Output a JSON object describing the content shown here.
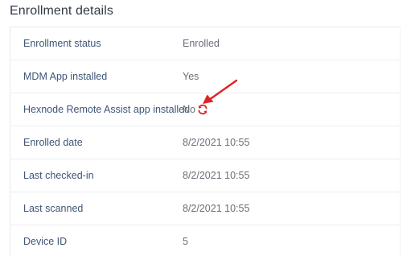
{
  "section": {
    "title": "Enrollment details"
  },
  "rows": [
    {
      "label": "Enrollment status",
      "value": "Enrolled"
    },
    {
      "label": "MDM App installed",
      "value": "Yes"
    },
    {
      "label": "Hexnode Remote Assist app installed",
      "value": "No",
      "icon": "refresh-sync-icon"
    },
    {
      "label": "Enrolled date",
      "value": "8/2/2021 10:55"
    },
    {
      "label": "Last checked-in",
      "value": "8/2/2021 10:55"
    },
    {
      "label": "Last scanned",
      "value": "8/2/2021 10:55"
    },
    {
      "label": "Device ID",
      "value": "5"
    }
  ],
  "colors": {
    "label": "#3e5577",
    "value": "#6a6f78",
    "accent_red": "#e02424"
  },
  "annotation": {
    "icon": "red-arrow-icon"
  }
}
